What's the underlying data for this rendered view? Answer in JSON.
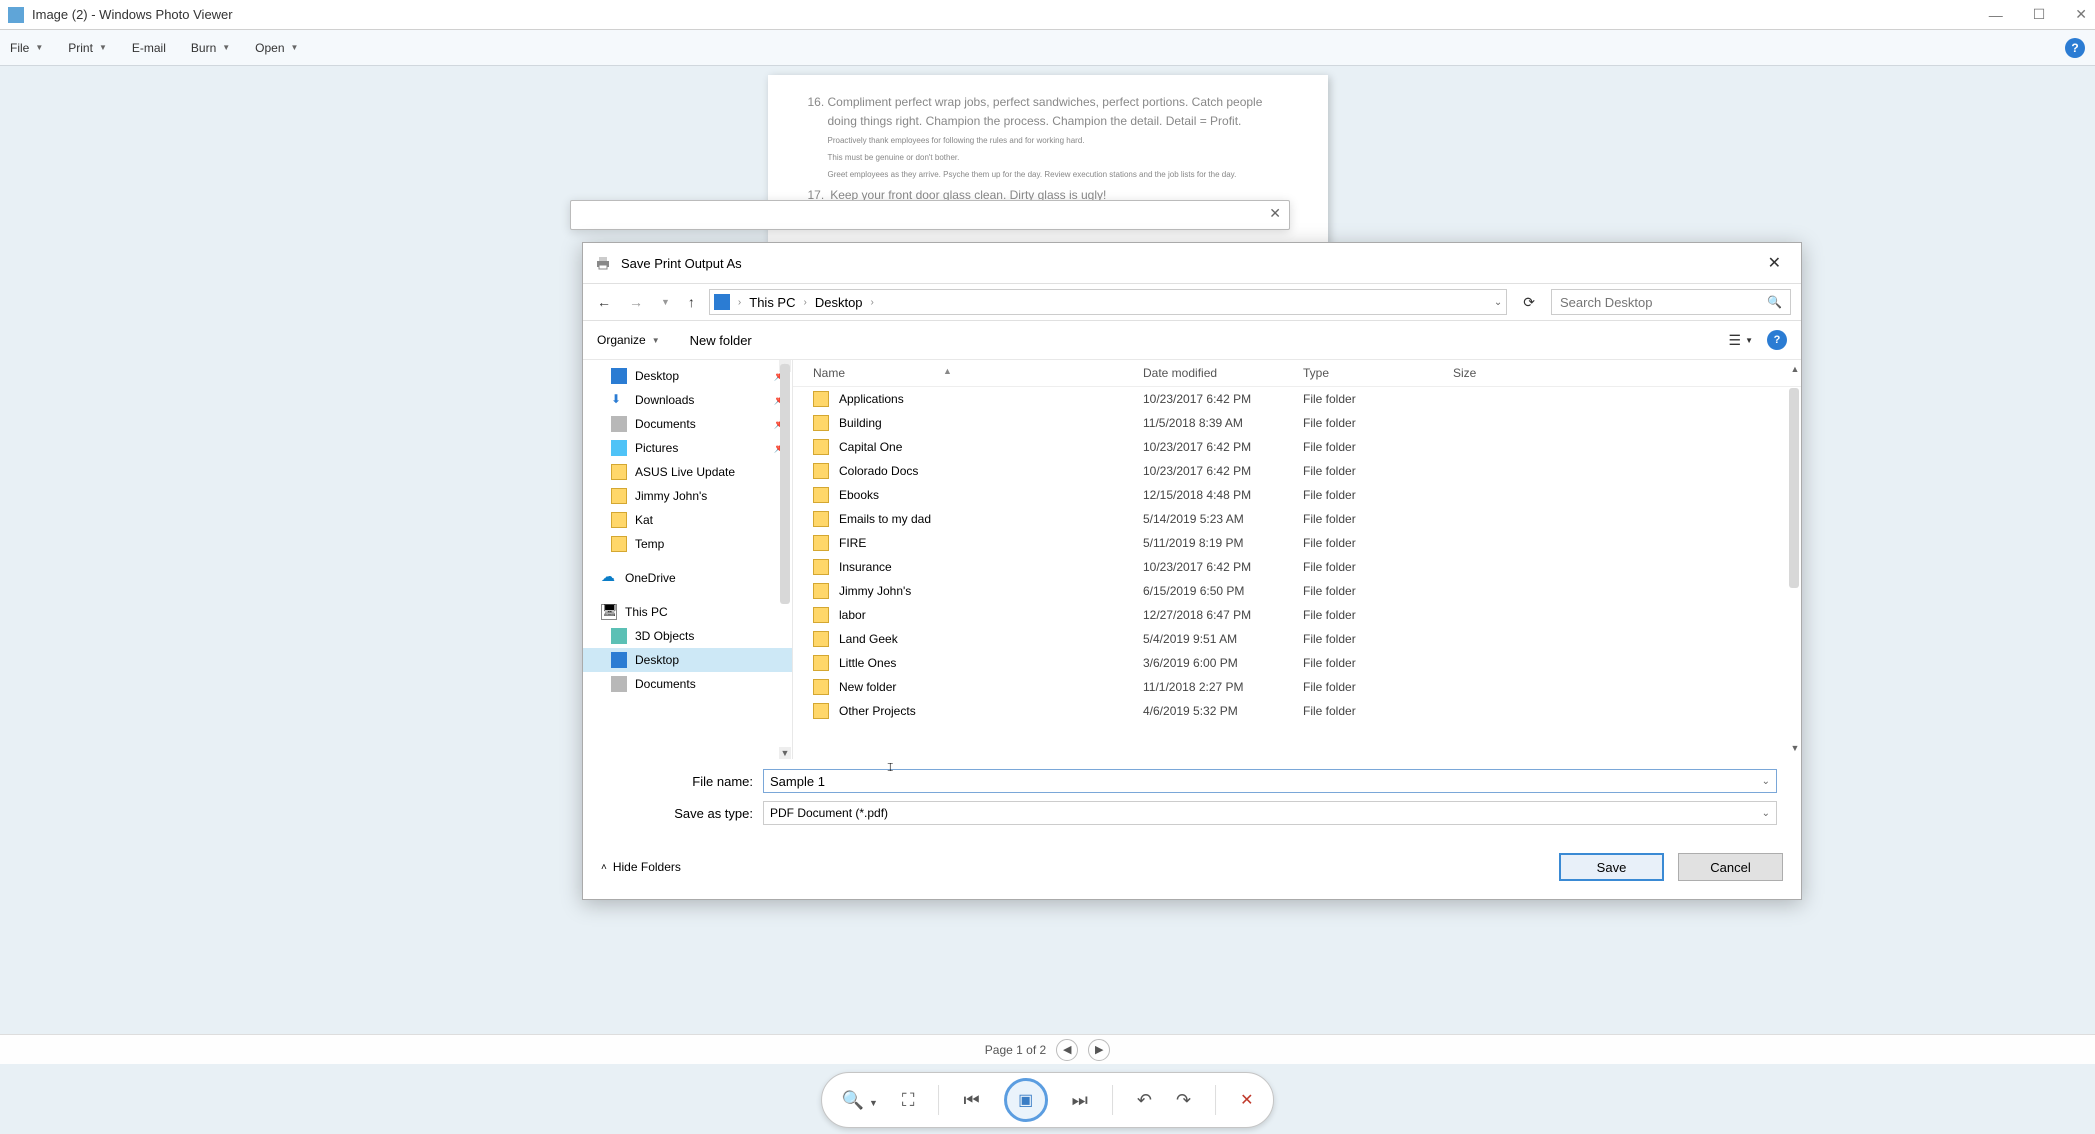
{
  "window": {
    "title": "Image (2) - Windows Photo Viewer"
  },
  "menu": {
    "file": "File",
    "print": "Print",
    "email": "E-mail",
    "burn": "Burn",
    "open": "Open"
  },
  "doc_lines": {
    "l16_num": "16.",
    "l16": "Compliment perfect wrap jobs, perfect sandwiches, perfect portions. Catch people doing things right. Champion the process. Champion the detail. Detail = Profit.",
    "l16b": "Proactively thank employees for following the rules and for working hard.",
    "l16c": "This must be genuine or don't bother.",
    "l16d": "Greet employees as they arrive. Psyche them up for the day. Review execution stations and the job lists for the day.",
    "l17_num": "17.",
    "l17": "Keep your front door glass clean. Dirty glass is ugly!"
  },
  "dialog": {
    "title": "Save Print Output As",
    "breadcrumb": {
      "this_pc": "This PC",
      "desktop": "Desktop"
    },
    "search_placeholder": "Search Desktop",
    "organize": "Organize",
    "new_folder": "New folder",
    "columns": {
      "name": "Name",
      "date": "Date modified",
      "type": "Type",
      "size": "Size"
    },
    "tree": {
      "desktop": "Desktop",
      "downloads": "Downloads",
      "documents": "Documents",
      "pictures": "Pictures",
      "asus": "ASUS Live Update",
      "jimmy": "Jimmy John's",
      "kat": "Kat",
      "temp": "Temp",
      "onedrive": "OneDrive",
      "this_pc": "This PC",
      "objects3d": "3D Objects",
      "desktop2": "Desktop",
      "documents2": "Documents"
    },
    "files": [
      {
        "name": "Applications",
        "date": "10/23/2017 6:42 PM",
        "type": "File folder"
      },
      {
        "name": "Building",
        "date": "11/5/2018 8:39 AM",
        "type": "File folder"
      },
      {
        "name": "Capital One",
        "date": "10/23/2017 6:42 PM",
        "type": "File folder"
      },
      {
        "name": "Colorado Docs",
        "date": "10/23/2017 6:42 PM",
        "type": "File folder"
      },
      {
        "name": "Ebooks",
        "date": "12/15/2018 4:48 PM",
        "type": "File folder"
      },
      {
        "name": "Emails to my dad",
        "date": "5/14/2019 5:23 AM",
        "type": "File folder"
      },
      {
        "name": "FIRE",
        "date": "5/11/2019 8:19 PM",
        "type": "File folder"
      },
      {
        "name": "Insurance",
        "date": "10/23/2017 6:42 PM",
        "type": "File folder"
      },
      {
        "name": "Jimmy John's",
        "date": "6/15/2019 6:50 PM",
        "type": "File folder"
      },
      {
        "name": "labor",
        "date": "12/27/2018 6:47 PM",
        "type": "File folder"
      },
      {
        "name": "Land Geek",
        "date": "5/4/2019 9:51 AM",
        "type": "File folder"
      },
      {
        "name": "Little Ones",
        "date": "3/6/2019 6:00 PM",
        "type": "File folder"
      },
      {
        "name": "New folder",
        "date": "11/1/2018 2:27 PM",
        "type": "File folder"
      },
      {
        "name": "Other Projects",
        "date": "4/6/2019 5:32 PM",
        "type": "File folder"
      }
    ],
    "filename_label": "File name:",
    "filename_value": "Sample 1",
    "saveas_label": "Save as type:",
    "saveas_value": "PDF Document (*.pdf)",
    "hide_folders": "Hide Folders",
    "save_btn": "Save",
    "cancel_btn": "Cancel"
  },
  "pagenav": {
    "text": "Page 1 of 2"
  }
}
